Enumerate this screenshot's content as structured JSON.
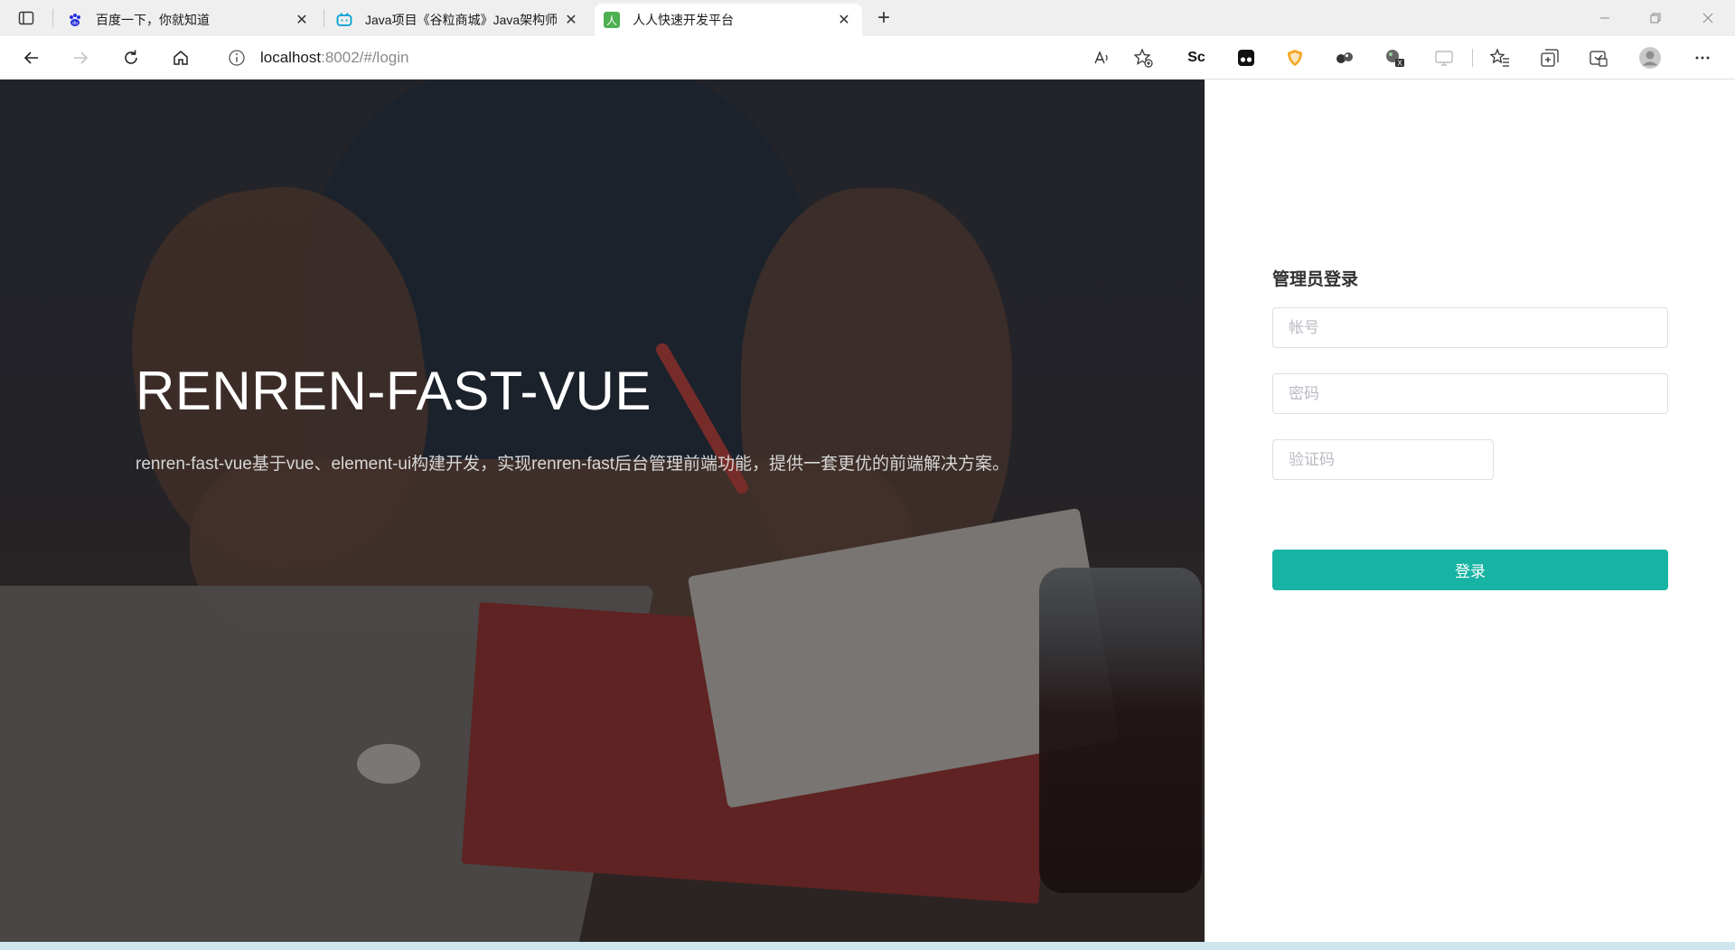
{
  "browser": {
    "tabs": [
      {
        "title": "百度一下，你就知道",
        "favicon": "baidu-paw-icon",
        "active": false
      },
      {
        "title": "Java项目《谷粒商城》Java架构师",
        "favicon": "bilibili-tv-icon",
        "active": false
      },
      {
        "title": "人人快速开发平台",
        "favicon": "renren-icon",
        "active": true
      }
    ],
    "new_tab": "+",
    "url_host": "localhost",
    "url_rest": ":8002/#/login",
    "extensions": [
      "sc-extension-icon",
      "tampermonkey-icon",
      "brave-shield-icon",
      "glasses-icon",
      "globe-x-icon",
      "cast-icon"
    ],
    "renren_favicon_text": "人",
    "ext_sc_label": "Sc",
    "colors": {
      "accent": "#17b3a3",
      "renren_green": "#4caf50",
      "bilibili_blue": "#00a1d6",
      "baidu_blue": "#2932e1"
    }
  },
  "hero": {
    "title": "RENREN-FAST-VUE",
    "description": "renren-fast-vue基于vue、element-ui构建开发，实现renren-fast后台管理前端功能，提供一套更优的前端解决方案。"
  },
  "login": {
    "title": "管理员登录",
    "username_placeholder": "帐号",
    "password_placeholder": "密码",
    "captcha_placeholder": "验证码",
    "submit_label": "登录"
  }
}
